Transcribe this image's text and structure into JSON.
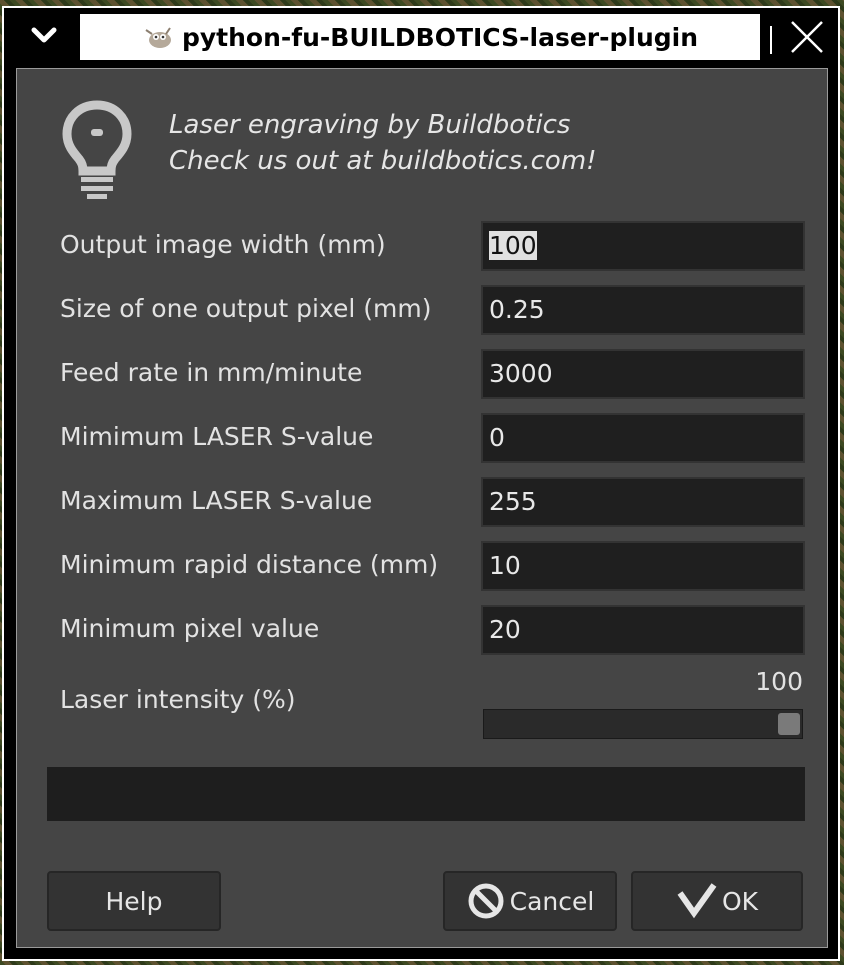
{
  "window": {
    "title": "python-fu-BUILDBOTICS-laser-plugin",
    "menu_icon": "chevron-down-icon",
    "app_icon": "gimp-wilber-icon",
    "close_icon": "close-icon"
  },
  "header": {
    "icon": "lightbulb-icon",
    "line1": "Laser engraving by Buildbotics",
    "line2": "Check us out at buildbotics.com!"
  },
  "fields": [
    {
      "label": "Output image width (mm)",
      "value": "100"
    },
    {
      "label": "Size of one output pixel (mm)",
      "value": "0.25"
    },
    {
      "label": "Feed rate in mm/minute",
      "value": "3000"
    },
    {
      "label": "Mimimum LASER S-value",
      "value": "0"
    },
    {
      "label": "Maximum LASER S-value",
      "value": "255"
    },
    {
      "label": "Minimum rapid distance (mm)",
      "value": "10"
    },
    {
      "label": "Minimum pixel value",
      "value": "20"
    }
  ],
  "slider": {
    "label": "Laser intensity (%)",
    "value": "100",
    "fraction": 1.0
  },
  "buttons": {
    "help": "Help",
    "cancel": "Cancel",
    "cancel_icon": "cancel-circle-icon",
    "ok": "OK",
    "ok_icon": "checkmark-icon"
  },
  "colors": {
    "dialog_bg": "#454545",
    "entry_bg": "#1f1f1f",
    "text": "#e2e2e2"
  }
}
